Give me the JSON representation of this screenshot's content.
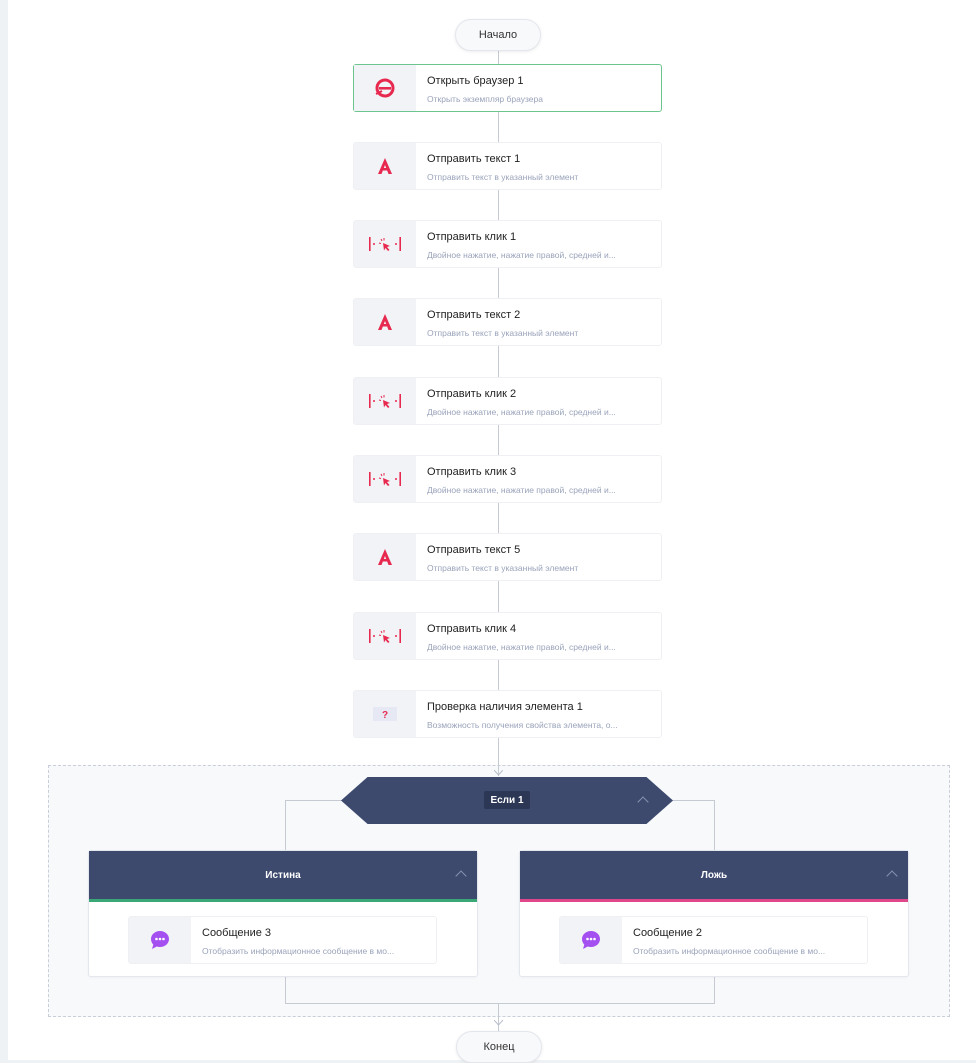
{
  "flow": {
    "start_label": "Начало",
    "end_label": "Конец",
    "nodes": [
      {
        "title": "Открыть браузер 1",
        "desc": "Открыть экземпляр браузера",
        "icon": "browser-icon"
      },
      {
        "title": "Отправить текст 1",
        "desc": "Отправить текст в указанный элемент",
        "icon": "send-text-icon"
      },
      {
        "title": "Отправить клик 1",
        "desc": "Двойное нажатие, нажатие правой, средней и...",
        "icon": "send-click-icon"
      },
      {
        "title": "Отправить текст 2",
        "desc": "Отправить текст в указанный элемент",
        "icon": "send-text-icon"
      },
      {
        "title": "Отправить клик 2",
        "desc": "Двойное нажатие, нажатие правой, средней и...",
        "icon": "send-click-icon"
      },
      {
        "title": "Отправить клик 3",
        "desc": "Двойное нажатие, нажатие правой, средней и...",
        "icon": "send-click-icon"
      },
      {
        "title": "Отправить текст 5",
        "desc": "Отправить текст в указанный элемент",
        "icon": "send-text-icon"
      },
      {
        "title": "Отправить клик 4",
        "desc": "Двойное нажатие, нажатие правой, средней и...",
        "icon": "send-click-icon"
      },
      {
        "title": "Проверка наличия элемента 1",
        "desc": "Возможность получения свойства элемента, о...",
        "icon": "question-icon"
      }
    ],
    "condition": {
      "label": "Если 1",
      "true_branch": {
        "label": "Истина",
        "accent": "#3aa876",
        "node": {
          "title": "Сообщение 3",
          "desc": "Отобразить информационное сообщение в мо...",
          "icon": "message-icon"
        }
      },
      "false_branch": {
        "label": "Ложь",
        "accent": "#e0468a",
        "node": {
          "title": "Сообщение 2",
          "desc": "Отобразить информационное сообщение в мо...",
          "icon": "message-icon"
        }
      }
    }
  },
  "colors": {
    "header": "#3d4a6e",
    "icon_red": "#e8294f",
    "selected_border": "#6cc58f",
    "message_purple": "#a44ff0"
  }
}
